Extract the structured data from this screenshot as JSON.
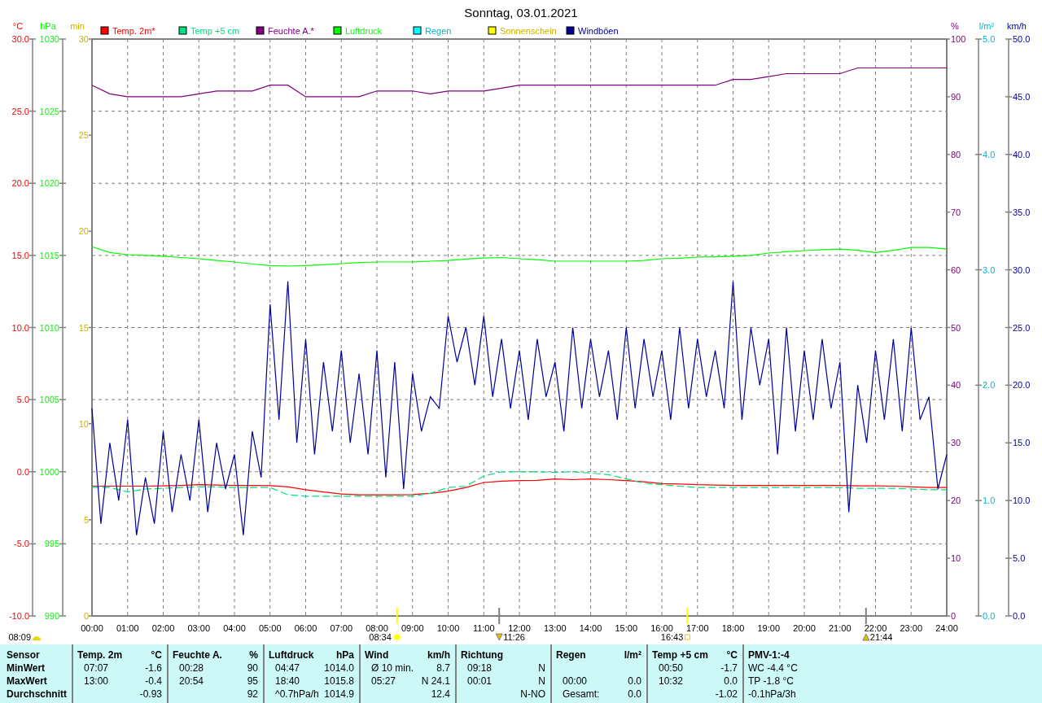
{
  "title": "Sonntag, 03.01.2021",
  "charts": [
    {
      "unit": "°C",
      "chart_data": {
        "type": "line",
        "grid": true,
        "xlim": [
          0,
          24
        ],
        "ylim": [
          -10,
          30
        ],
        "yticks": [
          {
            "value": 30,
            "label": "30.0"
          },
          {
            "value": 25,
            "label": "25.0"
          },
          {
            "value": 20,
            "label": "20.0"
          },
          {
            "value": 15,
            "label": "15.0"
          },
          {
            "value": 10,
            "label": "10.0"
          },
          {
            "value": 5,
            "label": "5.0"
          },
          {
            "value": 0,
            "label": "0.0"
          },
          {
            "value": -5,
            "label": "-5.0"
          },
          {
            "value": -10,
            "label": "-10.0"
          }
        ],
        "xticks": [
          {
            "value": 0,
            "label": "00:00"
          },
          {
            "value": 1,
            "label": "01:00"
          },
          {
            "value": 2,
            "label": "02:00"
          },
          {
            "value": 3,
            "label": "03:00"
          },
          {
            "value": 4,
            "label": "04:00"
          },
          {
            "value": 5,
            "label": "05:00"
          },
          {
            "value": 6,
            "label": "06:00"
          },
          {
            "value": 7,
            "label": "07:00"
          },
          {
            "value": 8,
            "label": "08:00"
          },
          {
            "value": 9,
            "label": "09:00"
          },
          {
            "value": 10,
            "label": "10:00"
          },
          {
            "value": 11,
            "label": "11:00"
          },
          {
            "value": 12,
            "label": "12:00"
          },
          {
            "value": 13,
            "label": "13:00"
          },
          {
            "value": 14,
            "label": "14:00"
          },
          {
            "value": 15,
            "label": "15:00"
          },
          {
            "value": 16,
            "label": "16:00"
          },
          {
            "value": 17,
            "label": "17:00"
          },
          {
            "value": 18,
            "label": "18:00"
          },
          {
            "value": 19,
            "label": "19:00"
          },
          {
            "value": 20,
            "label": "20:00"
          },
          {
            "value": 21,
            "label": "21:00"
          },
          {
            "value": 22,
            "label": "22:00"
          },
          {
            "value": 23,
            "label": "23:00"
          },
          {
            "value": 24,
            "label": "24:00"
          }
        ],
        "x": [
          0,
          0.5,
          1,
          1.5,
          2,
          2.5,
          3,
          3.5,
          4,
          4.5,
          5,
          5.5,
          6,
          6.5,
          7,
          7.5,
          8,
          8.5,
          9,
          9.5,
          10,
          10.5,
          11,
          11.5,
          12,
          12.5,
          13,
          13.5,
          14,
          14.5,
          15,
          15.5,
          16,
          16.5,
          17,
          17.5,
          18,
          18.5,
          19,
          19.5,
          20,
          20.5,
          21,
          21.5,
          22,
          22.5,
          23,
          23.5,
          24
        ],
        "series": [
          {
            "name": "Temp. 2m*",
            "color": "#ff0000",
            "values": [
              -1.0,
              -1.0,
              -1.0,
              -1.0,
              -0.98,
              -0.95,
              -0.9,
              -0.92,
              -0.95,
              -0.95,
              -0.97,
              -1.05,
              -1.25,
              -1.4,
              -1.55,
              -1.6,
              -1.6,
              -1.6,
              -1.58,
              -1.5,
              -1.35,
              -1.1,
              -0.75,
              -0.65,
              -0.62,
              -0.6,
              -0.5,
              -0.55,
              -0.5,
              -0.55,
              -0.62,
              -0.7,
              -0.82,
              -0.85,
              -0.9,
              -0.92,
              -0.95,
              -0.95,
              -0.95,
              -0.95,
              -0.95,
              -0.95,
              -0.95,
              -0.98,
              -0.98,
              -1.0,
              -1.05,
              -1.1,
              -1.1
            ]
          },
          {
            "name": "Temp +5 cm",
            "color": "#00e080",
            "line_style": "dashed",
            "values": [
              -1.1,
              -1.1,
              -1.4,
              -1.2,
              -1.15,
              -1.1,
              -1.05,
              -1.05,
              -1.1,
              -1.1,
              -1.1,
              -1.6,
              -1.7,
              -1.7,
              -1.7,
              -1.7,
              -1.7,
              -1.7,
              -1.7,
              -1.5,
              -1.1,
              -1.0,
              -0.3,
              0.0,
              0.0,
              0.0,
              -0.05,
              0.0,
              -0.1,
              -0.2,
              -0.5,
              -0.8,
              -0.9,
              -1.0,
              -1.1,
              -1.1,
              -1.1,
              -1.1,
              -1.1,
              -1.1,
              -1.1,
              -1.1,
              -1.1,
              -1.15,
              -1.15,
              -1.15,
              -1.2,
              -1.25,
              -1.25
            ]
          }
        ]
      }
    },
    {
      "unit": "hPa",
      "chart_data": {
        "type": "line",
        "xlim": [
          0,
          24
        ],
        "ylim": [
          990,
          1030
        ],
        "yticks": [
          {
            "value": 1030,
            "label": "1030"
          },
          {
            "value": 1025,
            "label": "1025"
          },
          {
            "value": 1020,
            "label": "1020"
          },
          {
            "value": 1015,
            "label": "1015"
          },
          {
            "value": 1010,
            "label": "1010"
          },
          {
            "value": 1005,
            "label": "1005"
          },
          {
            "value": 1000,
            "label": "1000"
          },
          {
            "value": 995,
            "label": "995"
          },
          {
            "value": 990,
            "label": "990"
          }
        ],
        "x": [
          0,
          0.5,
          1,
          1.5,
          2,
          2.5,
          3,
          3.5,
          4,
          4.5,
          5,
          5.5,
          6,
          6.5,
          7,
          7.5,
          8,
          8.5,
          9,
          9.5,
          10,
          10.5,
          11,
          11.5,
          12,
          12.5,
          13,
          13.5,
          14,
          14.5,
          15,
          15.5,
          16,
          16.5,
          17,
          17.5,
          18,
          18.5,
          19,
          19.5,
          20,
          20.5,
          21,
          21.5,
          22,
          22.5,
          23,
          23.5,
          24
        ],
        "series": [
          {
            "name": "Luftdruck",
            "color": "#00ff00",
            "values": [
              1015.6,
              1015.2,
              1015.05,
              1015.0,
              1014.94,
              1014.85,
              1014.77,
              1014.65,
              1014.54,
              1014.4,
              1014.3,
              1014.26,
              1014.3,
              1014.35,
              1014.43,
              1014.5,
              1014.54,
              1014.54,
              1014.54,
              1014.6,
              1014.65,
              1014.75,
              1014.82,
              1014.85,
              1014.77,
              1014.7,
              1014.6,
              1014.6,
              1014.6,
              1014.6,
              1014.6,
              1014.65,
              1014.77,
              1014.8,
              1014.88,
              1014.9,
              1014.94,
              1015.0,
              1015.16,
              1015.25,
              1015.33,
              1015.4,
              1015.44,
              1015.35,
              1015.2,
              1015.35,
              1015.55,
              1015.55,
              1015.44
            ]
          }
        ]
      }
    },
    {
      "unit": "%",
      "chart_data": {
        "type": "line",
        "xlim": [
          0,
          24
        ],
        "ylim": [
          0,
          100
        ],
        "yticks": [
          {
            "value": 100,
            "label": "100"
          },
          {
            "value": 90,
            "label": "90"
          },
          {
            "value": 80,
            "label": "80"
          },
          {
            "value": 70,
            "label": "70"
          },
          {
            "value": 60,
            "label": "60"
          },
          {
            "value": 50,
            "label": "50"
          },
          {
            "value": 40,
            "label": "40"
          },
          {
            "value": 30,
            "label": "30"
          },
          {
            "value": 20,
            "label": "20"
          },
          {
            "value": 10,
            "label": "10"
          },
          {
            "value": 0,
            "label": "0"
          }
        ],
        "x": [
          0,
          0.5,
          1,
          1.5,
          2,
          2.5,
          3,
          3.5,
          4,
          4.5,
          5,
          5.5,
          6,
          6.5,
          7,
          7.5,
          8,
          8.5,
          9,
          9.5,
          10,
          10.5,
          11,
          11.5,
          12,
          12.5,
          13,
          13.5,
          14,
          14.5,
          15,
          15.5,
          16,
          16.5,
          17,
          17.5,
          18,
          18.5,
          19,
          19.5,
          20,
          20.5,
          21,
          21.5,
          22,
          22.5,
          23,
          23.5,
          24
        ],
        "series": [
          {
            "name": "Feuchte A.*",
            "color": "#800080",
            "values": [
              92,
              90.5,
              90,
              90,
              90,
              90,
              90.5,
              91,
              91,
              91,
              92,
              92,
              90,
              90,
              90,
              90,
              91,
              91,
              91,
              90.5,
              91,
              91,
              91,
              91.5,
              92,
              92,
              92,
              92,
              92,
              92,
              92,
              92,
              92,
              92,
              92,
              92,
              93,
              93,
              93.5,
              94,
              94,
              94,
              94,
              95,
              95,
              95,
              95,
              95,
              95
            ]
          }
        ]
      }
    },
    {
      "unit": "km/h",
      "chart_data": {
        "type": "line",
        "xlim": [
          0,
          24
        ],
        "ylim": [
          0,
          50
        ],
        "yticks": [
          {
            "value": 50,
            "label": "50.0"
          },
          {
            "value": 45,
            "label": "45.0"
          },
          {
            "value": 40,
            "label": "40.0"
          },
          {
            "value": 35,
            "label": "35.0"
          },
          {
            "value": 30,
            "label": "30.0"
          },
          {
            "value": 25,
            "label": "25.0"
          },
          {
            "value": 20,
            "label": "20.0"
          },
          {
            "value": 15,
            "label": "15.0"
          },
          {
            "value": 10,
            "label": "10.0"
          },
          {
            "value": 5,
            "label": "5.0"
          },
          {
            "value": 0,
            "label": "0.0"
          }
        ],
        "x": [
          0,
          0.25,
          0.5,
          0.75,
          1,
          1.25,
          1.5,
          1.75,
          2,
          2.25,
          2.5,
          2.75,
          3,
          3.25,
          3.5,
          3.75,
          4,
          4.25,
          4.5,
          4.75,
          5,
          5.25,
          5.5,
          5.75,
          6,
          6.25,
          6.5,
          6.75,
          7,
          7.25,
          7.5,
          7.75,
          8,
          8.25,
          8.5,
          8.75,
          9,
          9.25,
          9.5,
          9.75,
          10,
          10.25,
          10.5,
          10.75,
          11,
          11.25,
          11.5,
          11.75,
          12,
          12.25,
          12.5,
          12.75,
          13,
          13.25,
          13.5,
          13.75,
          14,
          14.25,
          14.5,
          14.75,
          15,
          15.25,
          15.5,
          15.75,
          16,
          16.25,
          16.5,
          16.75,
          17,
          17.25,
          17.5,
          17.75,
          18,
          18.25,
          18.5,
          18.75,
          19,
          19.25,
          19.5,
          19.75,
          20,
          20.25,
          20.5,
          20.75,
          21,
          21.25,
          21.5,
          21.75,
          22,
          22.25,
          22.5,
          22.75,
          23,
          23.25,
          23.5,
          23.75,
          24
        ],
        "series": [
          {
            "name": "Windböen",
            "color": "#000099",
            "values": [
              18,
              8,
              15,
              10,
              17,
              7,
              12,
              8,
              16,
              9,
              14,
              10,
              17,
              9,
              15,
              11,
              14,
              7,
              16,
              12,
              27,
              17,
              29,
              15,
              24,
              14,
              22,
              16,
              23,
              15,
              21,
              14,
              23,
              12,
              22,
              11,
              21,
              16,
              19,
              18,
              26,
              22,
              25,
              20,
              26,
              19,
              24,
              18,
              23,
              17,
              24,
              19,
              22,
              16,
              25,
              18,
              24,
              19,
              23,
              17,
              25,
              18,
              24,
              19,
              23,
              17,
              25,
              18,
              24,
              19,
              23,
              18,
              29,
              17,
              25,
              20,
              24,
              14,
              25,
              16,
              23,
              17,
              24,
              18,
              22,
              9,
              20,
              15,
              23,
              17,
              24,
              16,
              25,
              17,
              19,
              11,
              14
            ]
          }
        ]
      }
    }
  ],
  "extra_legend": [
    {
      "label": "Regen",
      "color": "#00ffff"
    },
    {
      "label": "Sonnenschein",
      "color": "#ffff00"
    }
  ],
  "extra_axes": [
    {
      "unit": "min",
      "ticks": [
        "30",
        "25",
        "20",
        "15",
        "10",
        "5",
        "0"
      ]
    },
    {
      "unit": "l/m²",
      "ticks": [
        "5.0",
        "4.0",
        "3.0",
        "2.0",
        "1.0",
        "0.0"
      ]
    }
  ],
  "markers": [
    {
      "label": "08:34"
    },
    {
      "label": "11:26"
    },
    {
      "label": "16:43"
    },
    {
      "label": "21:44"
    }
  ],
  "sunrise": {
    "label": "08:09"
  },
  "stats": {
    "row_labels": {
      "header": "Sensor",
      "min": "MinWert",
      "max": "MaxWert",
      "avg": "Durchschnitt"
    },
    "columns": [
      {
        "kind": "pair",
        "title": "Temp. 2m",
        "unit": "°C",
        "min": {
          "time": "07:07",
          "value": "-1.6"
        },
        "max": {
          "time": "13:00",
          "value": "-0.4"
        },
        "avg": {
          "value": "-0.93"
        }
      },
      {
        "kind": "pair",
        "title": "Feuchte A.",
        "unit": "%",
        "min": {
          "time": "00:28",
          "value": "90"
        },
        "max": {
          "time": "20:54",
          "value": "95"
        },
        "avg": {
          "value": "92"
        }
      },
      {
        "kind": "pair",
        "title": "Luftdruck",
        "unit": "hPa",
        "min": {
          "time": "04:47",
          "value": "1014.0"
        },
        "max": {
          "time": "18:40",
          "value": "1015.8"
        },
        "avg": {
          "time": "^0.7hPa/h",
          "value": "1014.9"
        }
      },
      {
        "kind": "pair",
        "title": "Wind",
        "unit": "km/h",
        "min": {
          "time": "Ø 10 min.",
          "value": "8.7"
        },
        "max": {
          "time": "05:27",
          "value": "N 24.1"
        },
        "avg": {
          "value": "12.4"
        }
      },
      {
        "kind": "pair",
        "title": "Richtung",
        "min": {
          "time": "09:18",
          "value": "N"
        },
        "max": {
          "time": "00:01",
          "value": "N"
        },
        "avg": {
          "value": "N-NO"
        }
      },
      {
        "kind": "pair",
        "title": "Regen",
        "unit": "l/m²",
        "max": {
          "time": "00:00",
          "value": "0.0"
        },
        "avg": {
          "time": "Gesamt:",
          "value": "0.0"
        }
      },
      {
        "kind": "pair",
        "title": "Temp +5 cm",
        "unit": "°C",
        "min": {
          "time": "00:50",
          "value": "-1.7"
        },
        "max": {
          "time": "10:32",
          "value": "0.0"
        },
        "avg": {
          "value": "-1.02"
        }
      },
      {
        "kind": "notes",
        "title": "PMV-1:-4",
        "lines": [
          "WC -4.4 °C",
          "TP -1.8 °C",
          "-0.1hPa/3h"
        ]
      }
    ]
  }
}
